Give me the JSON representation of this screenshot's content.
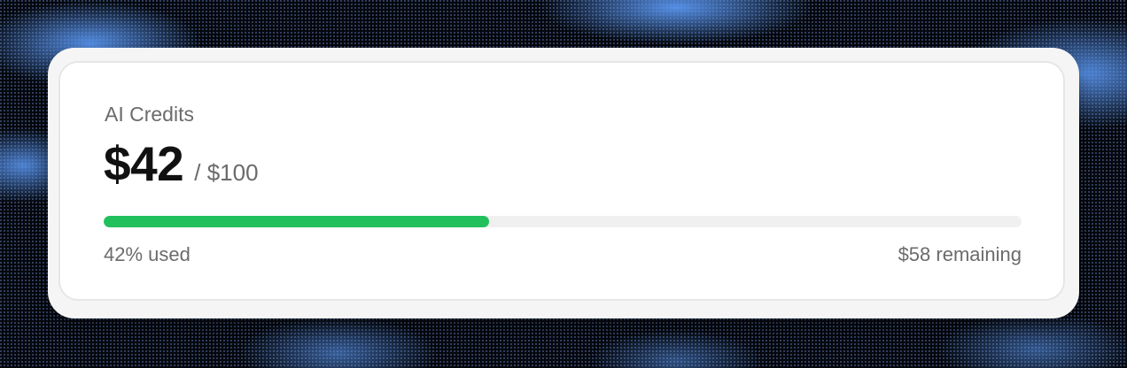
{
  "card": {
    "title": "AI Credits",
    "amount": "$42",
    "limit": "/ $100",
    "progress_fraction": 0.42,
    "used_label": "42% used",
    "remaining_label": "$58 remaining"
  },
  "colors": {
    "progress_fill": "#22c05c",
    "progress_track": "#f0f0f0",
    "amount_text": "#111111",
    "muted_text": "#6b6b6b",
    "background_accent": "#5a96f0"
  }
}
